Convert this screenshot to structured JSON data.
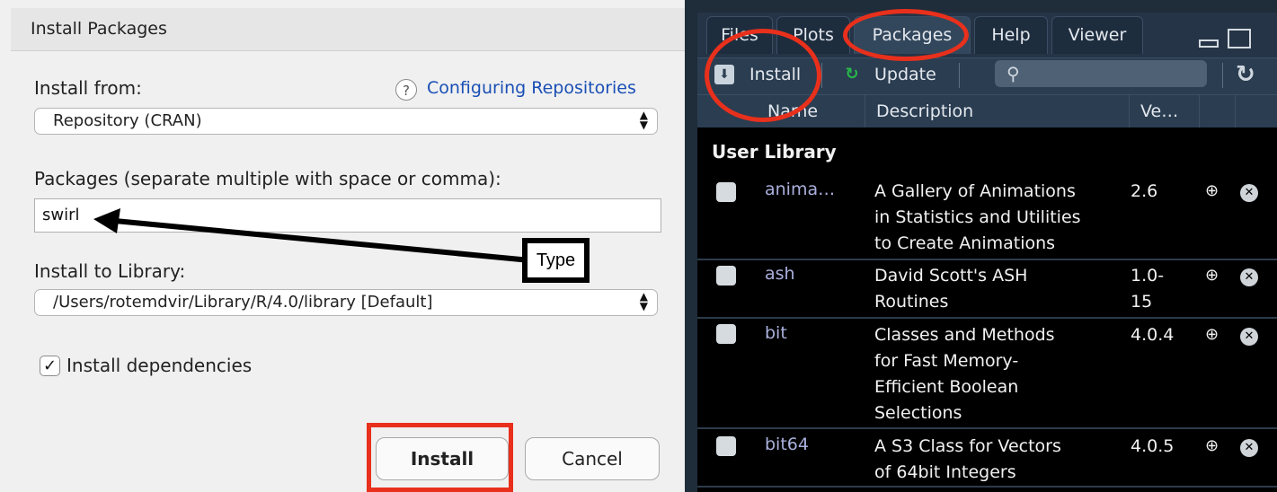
{
  "dialog": {
    "title": "Install Packages",
    "install_from_label": "Install from:",
    "help_icon_glyph": "?",
    "help_link": "Configuring Repositories",
    "repository_select": "Repository (CRAN)",
    "packages_label": "Packages (separate multiple with space or comma):",
    "packages_value": "swirl",
    "library_label": "Install to Library:",
    "library_select": "/Users/rotemdvir/Library/R/4.0/library [Default]",
    "dependencies_checked": true,
    "dependencies_label": "Install dependencies",
    "install_button": "Install",
    "cancel_button": "Cancel"
  },
  "annotation": {
    "type_label": "Type",
    "highlight_color": "#e8301c"
  },
  "pane": {
    "tabs": [
      "Files",
      "Plots",
      "Packages",
      "Help",
      "Viewer"
    ],
    "active_tab": "Packages",
    "toolbar": {
      "install_label": "Install",
      "update_label": "Update"
    },
    "columns": [
      "Name",
      "Description",
      "Ve…"
    ],
    "section_title": "User Library",
    "packages": [
      {
        "name": "anima…",
        "description": [
          "A Gallery of Animations",
          "in Statistics and Utilities",
          "to Create Animations"
        ],
        "version": [
          "2.6"
        ]
      },
      {
        "name": "ash",
        "description": [
          "David Scott's ASH",
          "Routines"
        ],
        "version": [
          "1.0-",
          "15"
        ]
      },
      {
        "name": "bit",
        "description": [
          "Classes and Methods",
          "for Fast Memory-",
          "Efficient Boolean",
          "Selections"
        ],
        "version": [
          "4.0.4"
        ]
      },
      {
        "name": "bit64",
        "description": [
          "A S3 Class for Vectors",
          "of 64bit Integers"
        ],
        "version": [
          "4.0.5"
        ]
      }
    ]
  }
}
